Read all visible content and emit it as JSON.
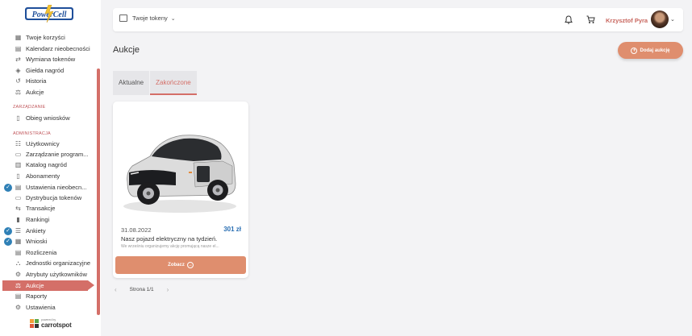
{
  "logo": {
    "text": "PowerCell"
  },
  "sidebar": {
    "items_main": [
      {
        "label": "Twoje korzyści",
        "icon": "grid-icon"
      },
      {
        "label": "Kalendarz nieobecności",
        "icon": "calendar-icon"
      },
      {
        "label": "Wymiana tokenów",
        "icon": "exchange-icon"
      },
      {
        "label": "Giełda nagród",
        "icon": "tag-icon"
      },
      {
        "label": "Historia",
        "icon": "history-icon"
      },
      {
        "label": "Aukcje",
        "icon": "auction-icon"
      }
    ],
    "section_zarzadzanie": "ZARZĄDZANIE",
    "items_zarz": [
      {
        "label": "Obieg wniosków",
        "icon": "doc-icon"
      }
    ],
    "section_admin": "ADMINISTRACJA",
    "items_admin": [
      {
        "label": "Użytkownicy",
        "icon": "users-icon"
      },
      {
        "label": "Zarządzanie program...",
        "icon": "folder-icon"
      },
      {
        "label": "Katalog nagród",
        "icon": "book-icon"
      },
      {
        "label": "Abonamenty",
        "icon": "doc-icon"
      },
      {
        "label": "Ustawienia nieobecn...",
        "icon": "calendar-settings-icon"
      },
      {
        "label": "Dystrybucja tokenów",
        "icon": "distribution-icon"
      },
      {
        "label": "Transakcje",
        "icon": "transfer-icon"
      },
      {
        "label": "Rankingi",
        "icon": "ranking-icon"
      },
      {
        "label": "Ankiety",
        "icon": "list-icon"
      },
      {
        "label": "Wnioski",
        "icon": "form-icon"
      },
      {
        "label": "Rozliczenia",
        "icon": "invoice-icon"
      },
      {
        "label": "Jednostki organizacyjne",
        "icon": "org-icon"
      },
      {
        "label": "Atrybuty użytkowników",
        "icon": "attributes-icon"
      },
      {
        "label": "Aukcje",
        "icon": "auction-icon"
      },
      {
        "label": "Raporty",
        "icon": "report-icon"
      },
      {
        "label": "Ustawienia",
        "icon": "settings-icon"
      }
    ],
    "powered_small": "powered by",
    "powered_brand": "carrotspot"
  },
  "topbar": {
    "tokens_label": "Twoje tokeny",
    "user_name": "Krzysztof Pyra"
  },
  "main": {
    "title": "Aukcje",
    "add_button": "Dodaj aukcję",
    "tabs": [
      "Aktualne",
      "Zakończone"
    ],
    "card": {
      "date": "31.08.2022",
      "price": "301 zł",
      "title": "Nasz pojazd elektryczny na tydzień.",
      "desc": "We wrześniu organizujemy akcję promującą nasze el...",
      "button": "Zobacz"
    },
    "pagination": "Strona 1/1"
  },
  "colors": {
    "accent": "#d46f68",
    "button": "#df8e6e",
    "price": "#2a6fb3",
    "badge": "#2f80b6"
  }
}
